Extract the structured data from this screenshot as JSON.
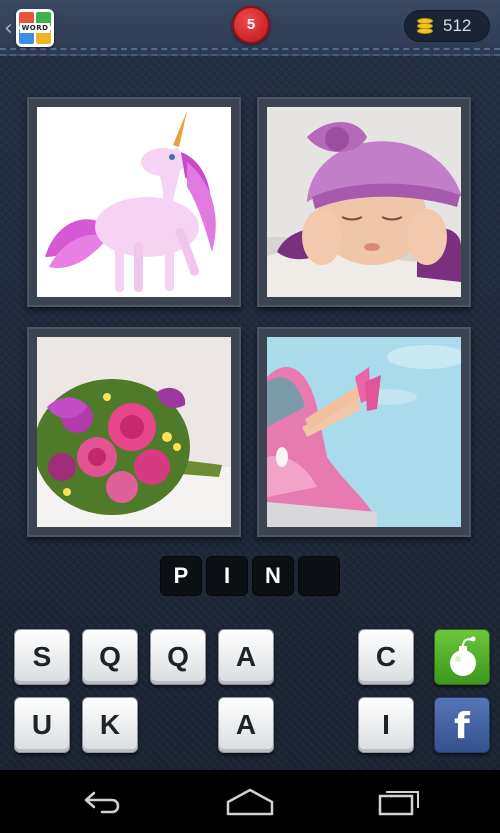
{
  "header": {
    "back_chevron": "‹",
    "logo_icon": "4-pics-1-word-logo",
    "logo_text": "WORD",
    "level": "5",
    "coins": "512",
    "coin_icon": "coin-stack-icon"
  },
  "pictures": [
    {
      "subject": "pink-unicorn-image"
    },
    {
      "subject": "sleeping-baby-pink-hat-image"
    },
    {
      "subject": "pink-rose-bouquet-image"
    },
    {
      "subject": "pink-car-feet-image"
    }
  ],
  "answer": {
    "slots": [
      "P",
      "I",
      "N",
      ""
    ]
  },
  "keyboard": {
    "row1": [
      "S",
      "Q",
      "Q",
      "A",
      "C"
    ],
    "row2": [
      "U",
      "K",
      "A",
      "I"
    ],
    "bomb_icon": "bomb-hint-icon",
    "facebook_label": "f"
  },
  "navbar": {
    "icons": [
      "back-icon",
      "home-icon",
      "recent-apps-icon"
    ]
  },
  "colors": {
    "level_badge": "#d71e26",
    "bomb_button": "#52ae2c",
    "facebook_button": "#3b5998",
    "background": "#1f2633"
  }
}
